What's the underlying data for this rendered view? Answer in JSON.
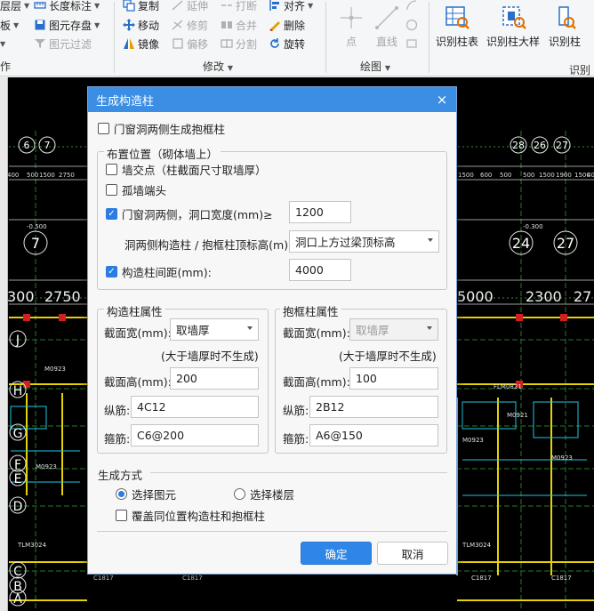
{
  "ribbon": {
    "floor_layer": "层层",
    "length_mark": "长度标注",
    "copy": "复制",
    "extend": "延伸",
    "break": "打断",
    "align": "对齐",
    "board": "板",
    "element_save": "图元存盘",
    "move": "移动",
    "trim": "修剪",
    "merge": "合并",
    "delete": "删除",
    "element_filter": "图元过滤",
    "mirror": "镜像",
    "offset": "偏移",
    "split": "分割",
    "rotate": "旋转",
    "point": "点",
    "line": "直线",
    "recognize_column_table": "识别柱表",
    "recognize_column_detail": "识别柱大样",
    "recognize_column": "识别柱",
    "group_op": "作",
    "group_modify": "修改",
    "group_draw": "绘图",
    "group_recognize": "识别"
  },
  "cad": {
    "axis_top": [
      "6",
      "7",
      "28",
      "26",
      "27"
    ],
    "axis_mid": [
      "7",
      "24",
      "27"
    ],
    "dims": [
      "300",
      "2750",
      "5000",
      "2300",
      "27"
    ],
    "axis_left": [
      "J",
      "H",
      "G",
      "F",
      "E",
      "D",
      "C",
      "B",
      "A"
    ],
    "small_dims": [
      "400",
      "500",
      "1500",
      "2750",
      "1500",
      "600",
      "500",
      "500",
      "1500",
      "1900",
      "1500",
      "400"
    ],
    "labels": [
      "-0.500",
      "-0.300",
      "M0923",
      "M0923",
      "M0923",
      "M0923",
      "TLM3024",
      "TLM3024",
      "C1817",
      "C1817",
      "C1817",
      "C1817",
      "FLM0821",
      "M0921"
    ]
  },
  "dialog": {
    "title": "生成构造柱",
    "close_icon": "×",
    "opt_door_window_frame": "门窗洞两侧生成抱框柱",
    "position_legend": "布置位置（砌体墙上）",
    "wall_intersection": "墙交点（柱截面尺寸取墙厚）",
    "isolated_wall_end": "孤墙端头",
    "door_window_sides": "门窗洞两侧，洞口宽度(mm)≥",
    "door_window_width": "1200",
    "top_elev_label": "洞两侧构造柱 / 抱框柱顶标高(m):",
    "top_elev_value": "洞口上方过梁顶标高",
    "spacing_label": "构造柱间距(mm):",
    "spacing_value": "4000",
    "col_props": {
      "legend": "构造柱属性",
      "width_label": "截面宽(mm):",
      "width_value": "取墙厚",
      "width_note": "(大于墙厚时不生成)",
      "height_label": "截面高(mm):",
      "height_value": "200",
      "long_label": "纵筋:",
      "long_value": "4C12",
      "stir_label": "箍筋:",
      "stir_value": "C6@200"
    },
    "frame_props": {
      "legend": "抱框柱属性",
      "width_label": "截面宽(mm):",
      "width_value": "取墙厚",
      "width_note": "(大于墙厚时不生成)",
      "height_label": "截面高(mm):",
      "height_value": "100",
      "long_label": "纵筋:",
      "long_value": "2B12",
      "stir_label": "箍筋:",
      "stir_value": "A6@150"
    },
    "gen_mode": "生成方式",
    "select_element": "选择图元",
    "select_floor": "选择楼层",
    "overwrite": "覆盖同位置构造柱和抱框柱",
    "ok": "确定",
    "cancel": "取消"
  },
  "colors": {
    "accent": "#2f86e8",
    "title_bar": "#3b8ee3",
    "cad_bg": "#000000"
  }
}
